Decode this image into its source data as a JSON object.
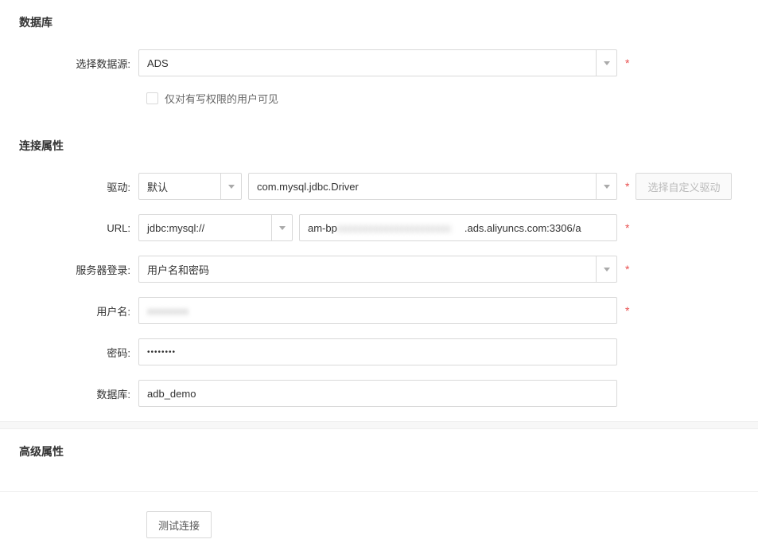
{
  "sections": {
    "database_title": "数据库",
    "conn_props_title": "连接属性",
    "advanced_title": "高级属性"
  },
  "labels": {
    "select_source": "选择数据源:",
    "driver": "驱动:",
    "url": "URL:",
    "server_login": "服务器登录:",
    "username": "用户名:",
    "password": "密码:",
    "database": "数据库:"
  },
  "values": {
    "data_source": "ADS",
    "visibility_checkbox": "仅对有写权限的用户可见",
    "driver_mode": "默认",
    "driver_class": "com.mysql.jdbc.Driver",
    "url_prefix": "jdbc:mysql://",
    "url_host_prefix": "am-bp",
    "url_host_blur": "xxxxxxxxxxxxxxxxxxxxxx",
    "url_host_suffix": ".ads.aliyuncs.com:3306/a",
    "server_login": "用户名和密码",
    "username_blur": "xxxxxxxx",
    "password": "••••••••",
    "database": "adb_demo"
  },
  "buttons": {
    "custom_driver": "选择自定义驱动",
    "test_connection": "测试连接"
  }
}
